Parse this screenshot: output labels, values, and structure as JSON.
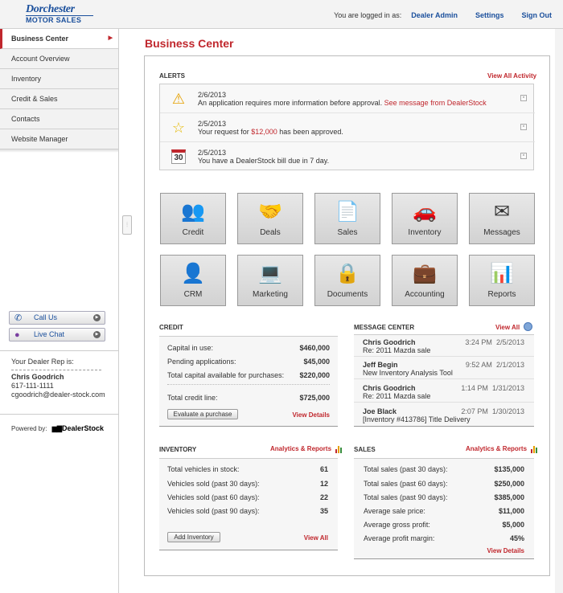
{
  "header": {
    "logo_line1": "Dorchester",
    "logo_line2": "MOTOR SALES",
    "logged_in_label": "You are logged in as:",
    "user": "Dealer Admin",
    "settings": "Settings",
    "signout": "Sign Out"
  },
  "sidebar": {
    "items": [
      {
        "label": "Business Center"
      },
      {
        "label": "Account Overview"
      },
      {
        "label": "Inventory"
      },
      {
        "label": "Credit & Sales"
      },
      {
        "label": "Contacts"
      },
      {
        "label": "Website Manager"
      }
    ],
    "call_us": "Call Us",
    "live_chat": "Live Chat",
    "rep_title": "Your Dealer Rep is:",
    "rep_name": "Chris Goodrich",
    "rep_phone": "617-111-1111",
    "rep_email": "cgoodrich@dealer-stock.com",
    "powered_by": "Powered by:",
    "powered_logo": "DealerStock"
  },
  "page_title": "Business Center",
  "alerts": {
    "title": "ALERTS",
    "view_all": "View All Activity",
    "items": [
      {
        "date": "2/6/2013",
        "text": "An application requires more information before approval.",
        "link": "See message from DealerStock",
        "icon": "warning-icon"
      },
      {
        "date": "2/5/2013",
        "text_pre": "Your request for",
        "amount": "$12,000",
        "text_post": "has been approved.",
        "icon": "star-icon"
      },
      {
        "date": "2/5/2013",
        "text": "You have a DealerStock bill due in 7 day.",
        "icon": "calendar-icon",
        "cal_day": "30"
      }
    ]
  },
  "tiles": [
    {
      "label": "Credit",
      "icon": "people-icon",
      "glyph": "👥"
    },
    {
      "label": "Deals",
      "icon": "handshake-icon",
      "glyph": "🤝"
    },
    {
      "label": "Sales",
      "icon": "report-icon",
      "glyph": "📄"
    },
    {
      "label": "Inventory",
      "icon": "car-icon",
      "glyph": "🚗"
    },
    {
      "label": "Messages",
      "icon": "envelope-icon",
      "glyph": "✉"
    },
    {
      "label": "CRM",
      "icon": "person-icon",
      "glyph": "👤"
    },
    {
      "label": "Marketing",
      "icon": "laptop-icon",
      "glyph": "💻"
    },
    {
      "label": "Documents",
      "icon": "locked-documents-icon",
      "glyph": "🔒"
    },
    {
      "label": "Accounting",
      "icon": "briefcase-icon",
      "glyph": "💼"
    },
    {
      "label": "Reports",
      "icon": "presentation-icon",
      "glyph": "📊"
    }
  ],
  "credit": {
    "title": "CREDIT",
    "rows": [
      {
        "label": "Capital in use:",
        "value": "$460,000"
      },
      {
        "label": "Pending applications:",
        "value": "$45,000"
      },
      {
        "label": "Total capital available for purchases:",
        "value": "$220,000"
      },
      {
        "label": "Total credit line:",
        "value": "$725,000"
      }
    ],
    "button": "Evaluate a purchase",
    "view_details": "View Details"
  },
  "message_center": {
    "title": "MESSAGE CENTER",
    "view_all": "View All",
    "items": [
      {
        "name": "Chris Goodrich",
        "subject": "Re: 2011 Mazda sale",
        "time": "3:24 PM",
        "date": "2/5/2013"
      },
      {
        "name": "Jeff Begin",
        "subject": "New Inventory Analysis Tool",
        "time": "9:52 AM",
        "date": "2/1/2013"
      },
      {
        "name": "Chris Goodrich",
        "subject": "Re: 2011 Mazda sale",
        "time": "1:14 PM",
        "date": "1/31/2013"
      },
      {
        "name": "Joe Black",
        "subject": "[Inventory #413786] Title Delivery",
        "time": "2:07 PM",
        "date": "1/30/2013"
      }
    ]
  },
  "inventory": {
    "title": "INVENTORY",
    "analytics": "Analytics & Reports",
    "rows": [
      {
        "label": "Total vehicles in stock:",
        "value": "61"
      },
      {
        "label": "Vehicles sold (past 30 days):",
        "value": "12"
      },
      {
        "label": "Vehicles sold (past 60 days):",
        "value": "22"
      },
      {
        "label": "Vehicles sold (past 90 days):",
        "value": "35"
      }
    ],
    "button": "Add Inventory",
    "view_all": "View All"
  },
  "sales": {
    "title": "SALES",
    "analytics": "Analytics & Reports",
    "rows": [
      {
        "label": "Total sales (past 30 days):",
        "value": "$135,000"
      },
      {
        "label": "Total sales (past 60 days):",
        "value": "$250,000"
      },
      {
        "label": "Total sales (past 90 days):",
        "value": "$385,000"
      },
      {
        "label": "Average sale price:",
        "value": "$11,000"
      },
      {
        "label": "Average gross profit:",
        "value": "$5,000"
      },
      {
        "label": "Average profit margin:",
        "value": "45%"
      }
    ],
    "view_details": "View Details"
  },
  "colors": {
    "accent_red": "#c0272d",
    "brand_blue": "#1a4f9c"
  }
}
